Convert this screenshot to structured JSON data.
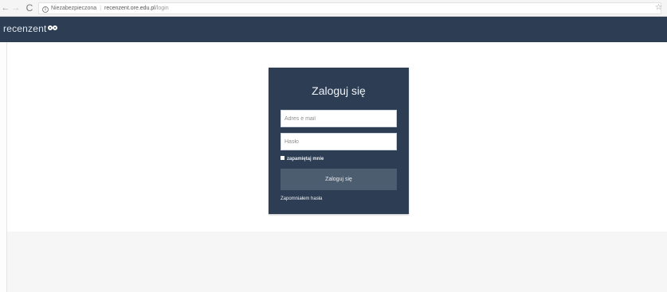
{
  "browser": {
    "back_icon": "←",
    "forward_icon": "→",
    "reload_icon": "C",
    "info_icon": "i",
    "security_text": "Niezabezpieczona",
    "separator": "|",
    "url_host": "recenzent.ore.edu.pl",
    "url_path": "/login",
    "star_icon": "☆"
  },
  "header": {
    "logo_text": "recenzent"
  },
  "login": {
    "title": "Zaloguj się",
    "email_placeholder": "Adres e mail",
    "password_placeholder": "Hasło",
    "remember_label": "zapamiętaj mnie",
    "submit_label": "Zaloguj się",
    "forgot_link": "Zapomniałem hasła"
  },
  "colors": {
    "header_bg": "#2d3e54",
    "card_bg": "#2d3e54",
    "button_bg": "#4d5d70",
    "footer_bg": "#f6f6f6"
  }
}
